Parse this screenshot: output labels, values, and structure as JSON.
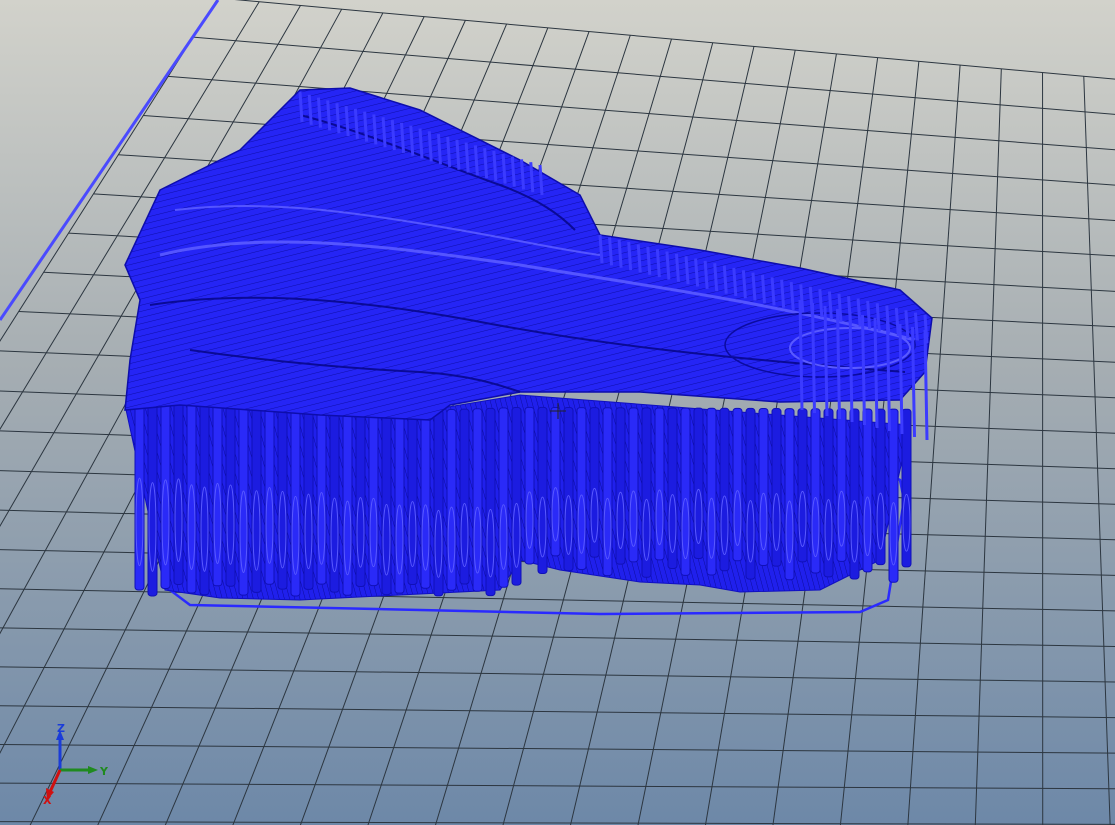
{
  "viewport": {
    "view": "3d-toolpath-preview",
    "colors": {
      "sky_top": "#d2d2cb",
      "sky_bottom": "#6d88a8",
      "grid_line": "#2c3640",
      "toolpath": "#2020ff",
      "toolpath_dark": "#1010b8",
      "toolpath_light": "#5a5aff"
    }
  },
  "axes": {
    "z_label": "Z",
    "y_label": "Y",
    "x_label": "X",
    "z_color": "#1a3cd9",
    "y_color": "#1f8a1f",
    "x_color": "#d01010"
  },
  "cursor": {
    "icon": "crosshair-cursor-icon"
  }
}
